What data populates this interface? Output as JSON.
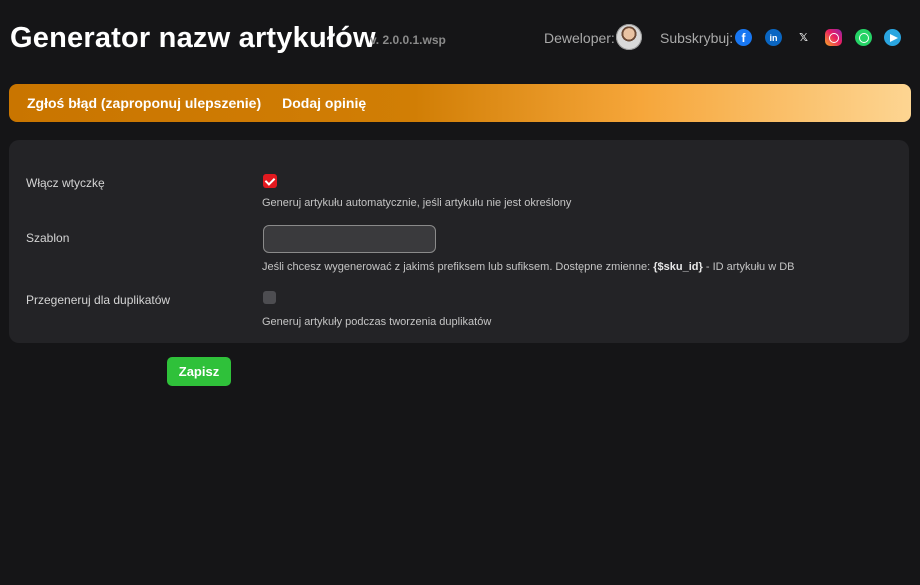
{
  "header": {
    "title": "Generator nazw artykułów",
    "version": "v. 2.0.0.1.wsp",
    "developer_label": "Deweloper:",
    "subscribe_label": "Subskrybuj:",
    "social": [
      {
        "name": "facebook-icon",
        "glyph": "f",
        "color": "#1877f2"
      },
      {
        "name": "linkedin-icon",
        "glyph": "in",
        "color": "#0a66c2"
      },
      {
        "name": "x-icon",
        "glyph": "𝕏",
        "color": "#e9e9e9"
      },
      {
        "name": "instagram-icon",
        "glyph": "",
        "color": "#e91e63"
      },
      {
        "name": "whatsapp-icon",
        "glyph": "",
        "color": "#25d366"
      },
      {
        "name": "telegram-icon",
        "glyph": "",
        "color": "#2aa5e0"
      }
    ]
  },
  "nav": {
    "report_bug": "Zgłoś błąd (zaproponuj ulepszenie)",
    "add_review": "Dodaj opinię"
  },
  "settings": {
    "enable_plugin": {
      "label": "Włącz wtyczkę",
      "checked": true,
      "hint": "Generuj artykułu automatycznie, jeśli artykułu nie jest określony"
    },
    "template": {
      "label": "Szablon",
      "value": "",
      "hint_before": "Jeśli chcesz wygenerować z jakimś prefiksem lub sufiksem. Dostępne zmienne: ",
      "hint_var": "{$sku_id}",
      "hint_after": " - ID artykułu w DB"
    },
    "regenerate_duplicates": {
      "label": "Przegeneruj dla duplikatów",
      "checked": false,
      "hint": "Generuj artykuły podczas tworzenia duplikatów"
    }
  },
  "actions": {
    "save_label": "Zapisz"
  },
  "colors": {
    "background": "#151517",
    "panel": "#232326",
    "accent_orange": "#c97500",
    "checkbox_red": "#e2191f",
    "save_green": "#2fc13a"
  }
}
